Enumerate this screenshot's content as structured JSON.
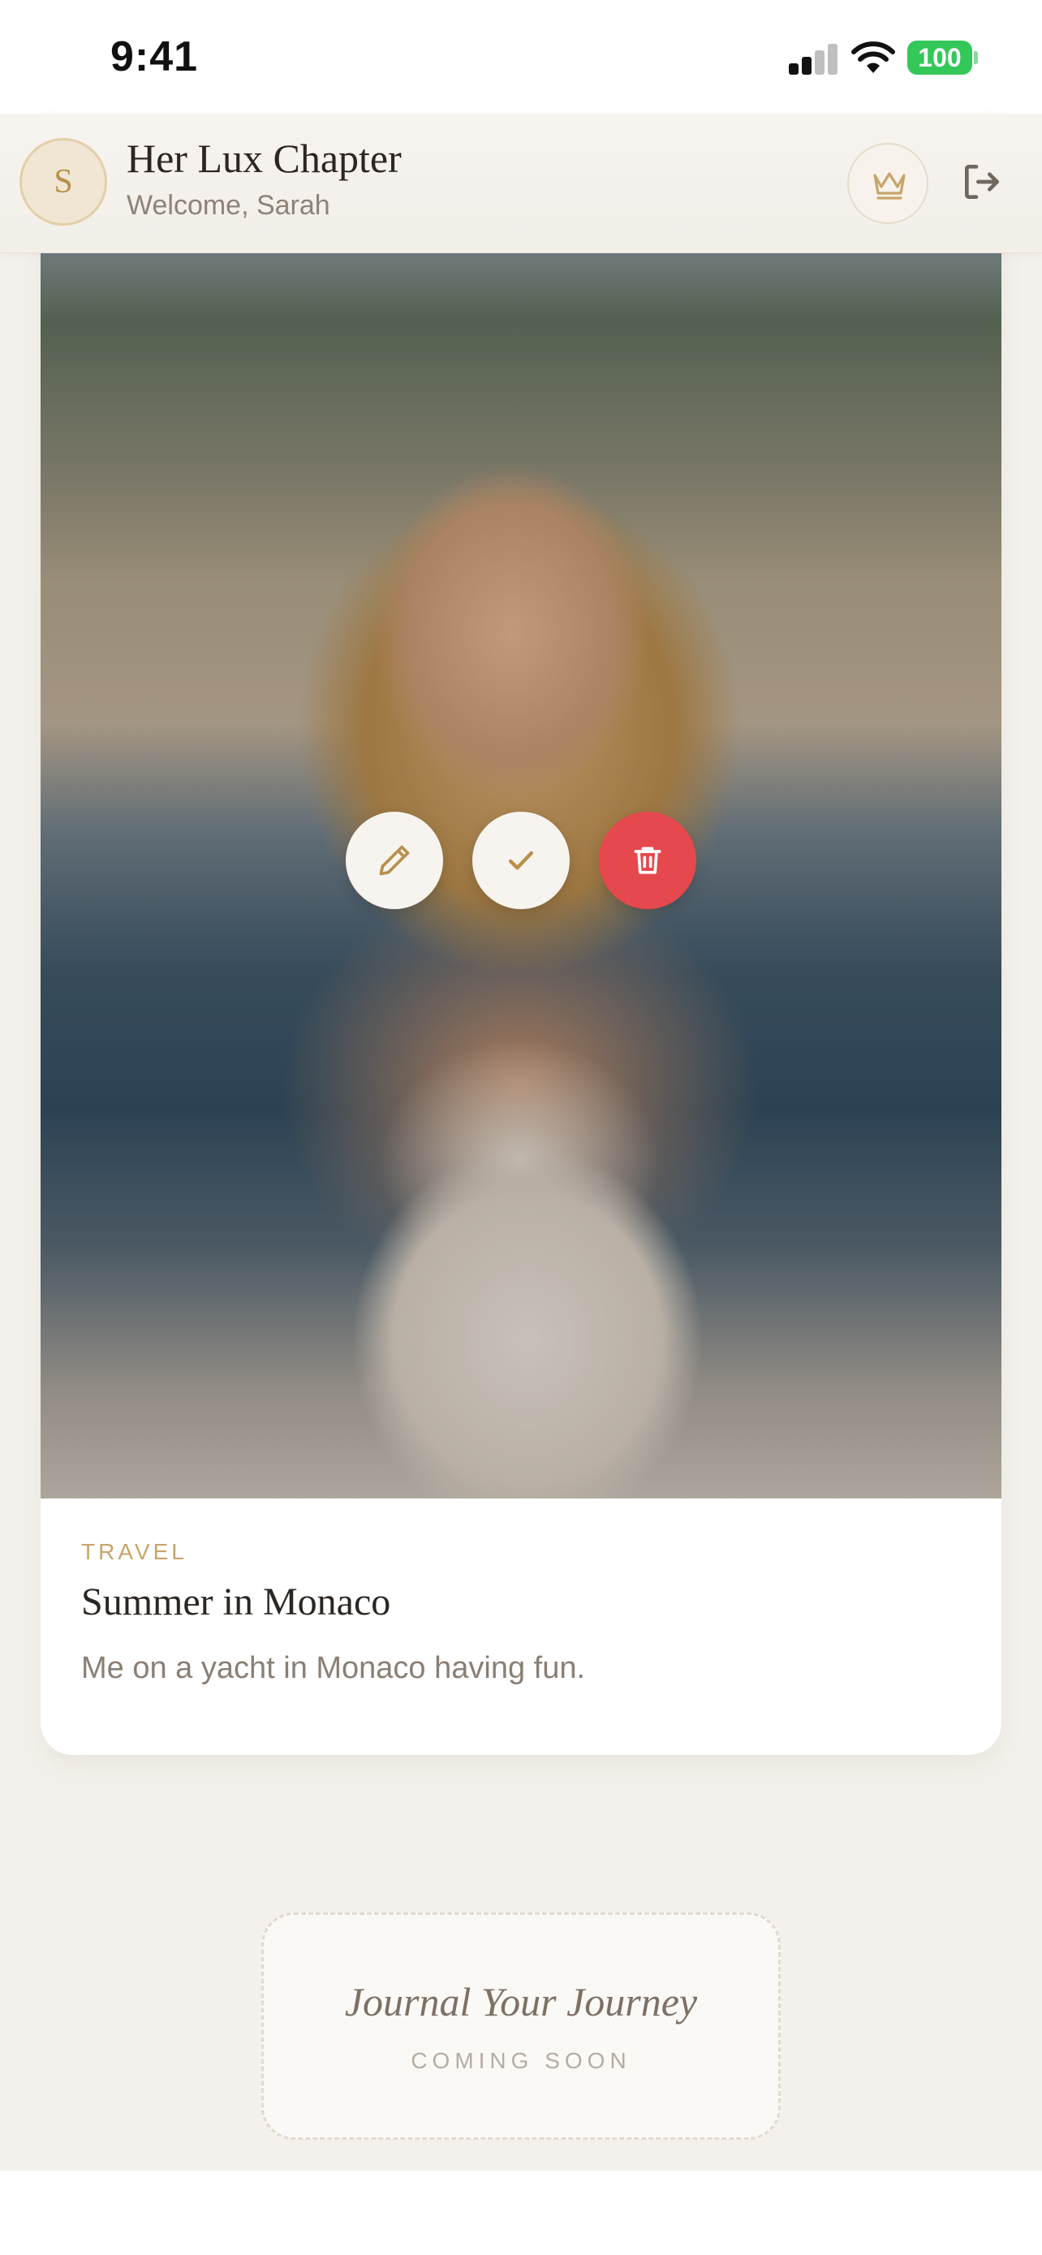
{
  "status_bar": {
    "time": "9:41",
    "battery": "100"
  },
  "header": {
    "avatar_initial": "S",
    "title": "Her Lux Chapter",
    "welcome": "Welcome, Sarah"
  },
  "card": {
    "category": "TRAVEL",
    "title": "Summer in Monaco",
    "description": "Me on a yacht in Monaco having fun."
  },
  "coming_soon": {
    "title": "Journal Your Journey",
    "subtitle": "COMING SOON"
  },
  "icons": [
    "signal-icon",
    "wifi-icon",
    "crown-icon",
    "logout-icon",
    "drag-handle-icon",
    "pencil-icon",
    "check-icon",
    "trash-icon"
  ],
  "colors": {
    "accent": "#b8904a",
    "delete": "#e5484d",
    "battery": "#34c759"
  }
}
